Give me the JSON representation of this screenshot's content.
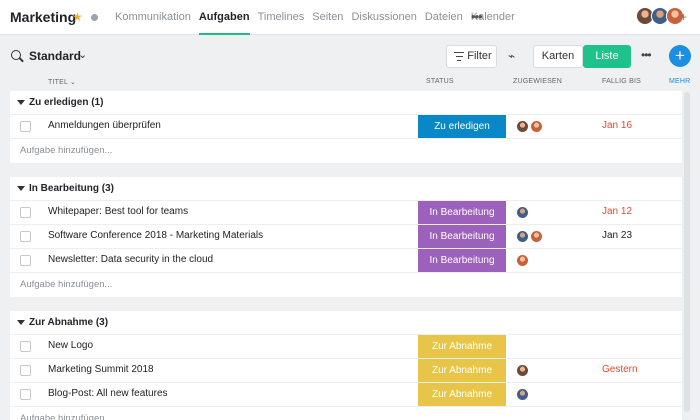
{
  "header": {
    "project_title": "Marketing",
    "tabs": [
      {
        "label": "Kommunikation",
        "active": false
      },
      {
        "label": "Aufgaben",
        "active": true
      },
      {
        "label": "Timelines",
        "active": false
      },
      {
        "label": "Seiten",
        "active": false
      },
      {
        "label": "Diskussionen",
        "active": false
      },
      {
        "label": "Dateien",
        "active": false
      },
      {
        "label": "Kalender",
        "active": false
      }
    ],
    "more_icon": "more-horizontal-icon",
    "plus_label": "+"
  },
  "toolbar": {
    "view_title": "Standard",
    "filter_label": "Filter",
    "karten_label": "Karten",
    "liste_label": "Liste",
    "add_label": "+"
  },
  "columns": {
    "titel": "TITEL",
    "status": "STATUS",
    "zugewiesen": "ZUGEWIESEN",
    "fallig": "FALLIG BIS",
    "mehr": "MEHR"
  },
  "colors": {
    "accent_green": "#1fc28a",
    "accent_blue": "#1d8fe0",
    "status_zu_erledigen": "#0a87c7",
    "status_in_bearbeitung": "#9c61bb",
    "status_zur_abnahme": "#e8c548",
    "overdue": "#e2492e"
  },
  "add_task_label": "Aufgabe hinzufügen...",
  "sections": [
    {
      "title": "Zu erledigen (1)",
      "tasks": [
        {
          "name": "Anmeldungen überprüfen",
          "status": "Zu erledigen",
          "assignees": [
            "a",
            "c"
          ],
          "due": "Jan 16",
          "overdue": true
        }
      ]
    },
    {
      "title": "In Bearbeitung (3)",
      "tasks": [
        {
          "name": "Whitepaper: Best tool for teams",
          "status": "In Bearbeitung",
          "assignees": [
            "b"
          ],
          "due": "Jan 12",
          "overdue": true
        },
        {
          "name": "Software Conference 2018 - Marketing Materials",
          "status": "In Bearbeitung",
          "assignees": [
            "b",
            "c"
          ],
          "due": "Jan 23",
          "overdue": false
        },
        {
          "name": "Newsletter: Data security in the cloud",
          "status": "In Bearbeitung",
          "assignees": [
            "c"
          ],
          "due": "",
          "overdue": false
        }
      ]
    },
    {
      "title": "Zur Abnahme (3)",
      "tasks": [
        {
          "name": "New Logo",
          "status": "Zur Abnahme",
          "assignees": [],
          "due": "",
          "overdue": false
        },
        {
          "name": "Marketing Summit 2018",
          "status": "Zur Abnahme",
          "assignees": [
            "a"
          ],
          "due": "Gestern",
          "overdue": true
        },
        {
          "name": "Blog-Post: All new features",
          "status": "Zur Abnahme",
          "assignees": [
            "b"
          ],
          "due": "",
          "overdue": false
        }
      ]
    }
  ]
}
